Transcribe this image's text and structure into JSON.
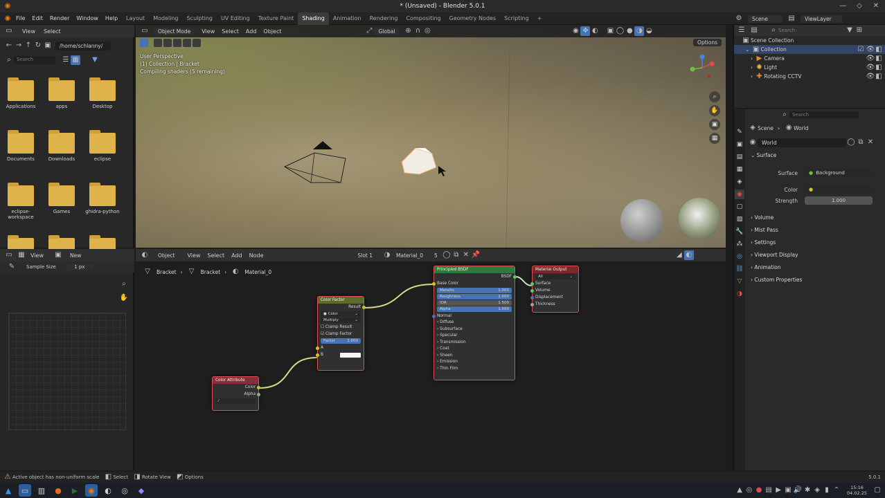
{
  "window": {
    "title": "* (Unsaved) - Blender 5.0.1"
  },
  "menu": [
    "File",
    "Edit",
    "Render",
    "Window",
    "Help"
  ],
  "workspaces": [
    "Layout",
    "Modeling",
    "Sculpting",
    "UV Editing",
    "Texture Paint",
    "Shading",
    "Animation",
    "Rendering",
    "Compositing",
    "Geometry Nodes",
    "Scripting"
  ],
  "active_workspace": "Shading",
  "scene": {
    "scene_name": "Scene",
    "view_layer": "ViewLayer"
  },
  "file_browser": {
    "menu": [
      "View",
      "Select"
    ],
    "path": "/home/schlanny/",
    "search_placeholder": "Search",
    "folders": [
      "Applications",
      "apps",
      "Desktop",
      "Documents",
      "Downloads",
      "eclipse",
      "eclipse-workspace",
      "Games",
      "ghidra-python"
    ]
  },
  "image_editor": {
    "menu": [
      "View"
    ],
    "new_label": "New",
    "sample_label": "Sample Size",
    "sample_value": "1 px"
  },
  "viewport": {
    "mode": "Object Mode",
    "menu": [
      "View",
      "Select",
      "Add",
      "Object"
    ],
    "orientation": "Global",
    "info_line1": "User Perspective",
    "info_line2": "(1) Collection | Bracket",
    "info_line3": "Compiling shaders (5 remaining)",
    "options_label": "Options"
  },
  "node_editor": {
    "type": "Object",
    "menu": [
      "View",
      "Select",
      "Add",
      "Node"
    ],
    "slot": "Slot 1",
    "material": "Material_0",
    "users": "5",
    "breadcrumb": [
      "Bracket",
      "Bracket",
      "Material_0"
    ],
    "nodes": {
      "color_attribute": {
        "title": "Color Attribute",
        "out_color": "Color",
        "out_alpha": "Alpha"
      },
      "color_factor": {
        "title": "Color Factor",
        "out_result": "Result",
        "type": "Color",
        "blend": "Multiply",
        "clamp_result": "Clamp Result",
        "clamp_factor": "Clamp Factor",
        "factor_label": "Factor",
        "factor_value": "1.000",
        "in_a": "A",
        "in_b": "B"
      },
      "bsdf": {
        "title": "Principled BSDF",
        "out": "BSDF",
        "base_color": "Base Color",
        "fields": [
          {
            "label": "Metallic",
            "value": "1.000"
          },
          {
            "label": "Roughness",
            "value": "1.000"
          },
          {
            "label": "IOR",
            "value": "1.500"
          },
          {
            "label": "Alpha",
            "value": "1.000"
          }
        ],
        "normal": "Normal",
        "sections": [
          "Diffuse",
          "Subsurface",
          "Specular",
          "Transmission",
          "Coat",
          "Sheen",
          "Emission",
          "Thin Film"
        ]
      },
      "output": {
        "title": "Material Output",
        "target": "All",
        "inputs": [
          "Surface",
          "Volume",
          "Displacement",
          "Thickness"
        ]
      }
    }
  },
  "outliner": {
    "search_placeholder": "Search",
    "root": "Scene Collection",
    "collection": "Collection",
    "items": [
      "Camera",
      "Light",
      "Rotating CCTV"
    ]
  },
  "properties": {
    "search_placeholder": "Search",
    "breadcrumb": [
      "Scene",
      "World"
    ],
    "world_name": "World",
    "surface_panel": "Surface",
    "surface_label": "Surface",
    "surface_value": "Background",
    "color_label": "Color",
    "strength_label": "Strength",
    "strength_value": "1.000",
    "panels": [
      "Volume",
      "Mist Pass",
      "Settings",
      "Viewport Display",
      "Animation",
      "Custom Properties"
    ]
  },
  "statusbar": {
    "warning": "Active object has non-uniform scale",
    "select": "Select",
    "rotate": "Rotate View",
    "options": "Options",
    "version": "5.0.1"
  },
  "taskbar": {
    "time": "15:16",
    "date": "04.02.25"
  },
  "colors": {
    "accent": "#4772b3",
    "folder": "#e0b24a",
    "node_border": "#e05050",
    "link": "#c7c729"
  }
}
